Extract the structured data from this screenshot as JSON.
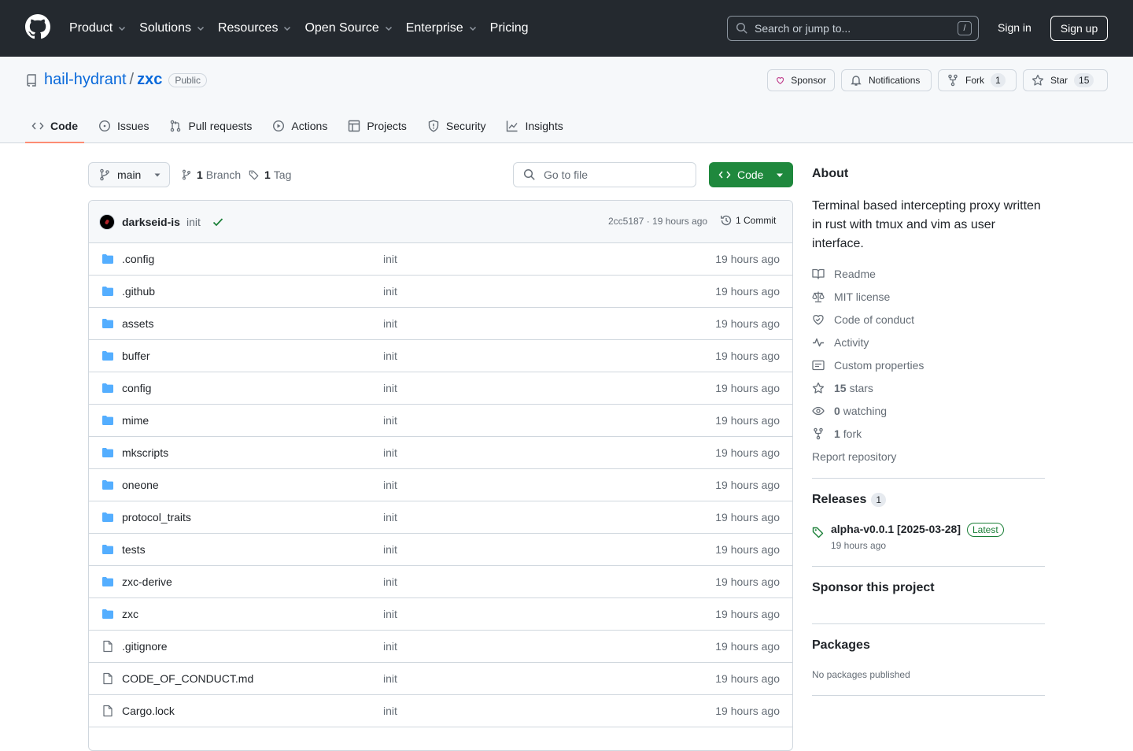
{
  "header": {
    "nav": [
      {
        "label": "Product",
        "has_dropdown": true
      },
      {
        "label": "Solutions",
        "has_dropdown": true
      },
      {
        "label": "Resources",
        "has_dropdown": true
      },
      {
        "label": "Open Source",
        "has_dropdown": true
      },
      {
        "label": "Enterprise",
        "has_dropdown": true
      },
      {
        "label": "Pricing",
        "has_dropdown": false
      }
    ],
    "search_placeholder": "Search or jump to...",
    "search_shortcut": "/",
    "sign_in": "Sign in",
    "sign_up": "Sign up"
  },
  "repo": {
    "owner": "hail-hydrant",
    "separator": "/",
    "name": "zxc",
    "visibility": "Public",
    "actions": {
      "sponsor": "Sponsor",
      "notifications": "Notifications",
      "fork": "Fork",
      "fork_count": "1",
      "star": "Star",
      "star_count": "15"
    },
    "tabs": [
      {
        "label": "Code",
        "icon": "code-icon",
        "active": true
      },
      {
        "label": "Issues",
        "icon": "issue-icon",
        "active": false
      },
      {
        "label": "Pull requests",
        "icon": "pull-request-icon",
        "active": false
      },
      {
        "label": "Actions",
        "icon": "play-icon",
        "active": false
      },
      {
        "label": "Projects",
        "icon": "table-icon",
        "active": false
      },
      {
        "label": "Security",
        "icon": "shield-icon",
        "active": false
      },
      {
        "label": "Insights",
        "icon": "graph-icon",
        "active": false
      }
    ]
  },
  "browser": {
    "branch": "main",
    "branch_count": "1",
    "branch_label": "Branch",
    "tag_count": "1",
    "tag_label": "Tag",
    "go_to_file": "Go to file",
    "code_button": "Code",
    "commit": {
      "author": "darkseid-is",
      "message": "init",
      "sha_time": "2cc5187 · 19 hours ago",
      "commits": "1 Commit"
    },
    "files": [
      {
        "name": ".config",
        "type": "dir",
        "message": "init",
        "age": "19 hours ago"
      },
      {
        "name": ".github",
        "type": "dir",
        "message": "init",
        "age": "19 hours ago"
      },
      {
        "name": "assets",
        "type": "dir",
        "message": "init",
        "age": "19 hours ago"
      },
      {
        "name": "buffer",
        "type": "dir",
        "message": "init",
        "age": "19 hours ago"
      },
      {
        "name": "config",
        "type": "dir",
        "message": "init",
        "age": "19 hours ago"
      },
      {
        "name": "mime",
        "type": "dir",
        "message": "init",
        "age": "19 hours ago"
      },
      {
        "name": "mkscripts",
        "type": "dir",
        "message": "init",
        "age": "19 hours ago"
      },
      {
        "name": "oneone",
        "type": "dir",
        "message": "init",
        "age": "19 hours ago"
      },
      {
        "name": "protocol_traits",
        "type": "dir",
        "message": "init",
        "age": "19 hours ago"
      },
      {
        "name": "tests",
        "type": "dir",
        "message": "init",
        "age": "19 hours ago"
      },
      {
        "name": "zxc-derive",
        "type": "dir",
        "message": "init",
        "age": "19 hours ago"
      },
      {
        "name": "zxc",
        "type": "dir",
        "message": "init",
        "age": "19 hours ago"
      },
      {
        "name": ".gitignore",
        "type": "file",
        "message": "init",
        "age": "19 hours ago"
      },
      {
        "name": "CODE_OF_CONDUCT.md",
        "type": "file",
        "message": "init",
        "age": "19 hours ago"
      },
      {
        "name": "Cargo.lock",
        "type": "file",
        "message": "init",
        "age": "19 hours ago"
      }
    ]
  },
  "about": {
    "heading": "About",
    "description": "Terminal based intercepting proxy written in rust with tmux and vim as user interface.",
    "links": [
      {
        "label": "Readme",
        "icon": "book-icon"
      },
      {
        "label": "MIT license",
        "icon": "law-icon"
      },
      {
        "label": "Code of conduct",
        "icon": "heart-hand-icon"
      },
      {
        "label": "Activity",
        "icon": "pulse-icon"
      },
      {
        "label": "Custom properties",
        "icon": "note-icon"
      }
    ],
    "stars_count": "15",
    "stars_label": "stars",
    "watching_count": "0",
    "watching_label": "watching",
    "fork_count": "1",
    "fork_label": "fork",
    "report": "Report repository"
  },
  "releases": {
    "heading": "Releases",
    "count": "1",
    "name": "alpha-v0.0.1 [2025-03-28]",
    "badge": "Latest",
    "time": "19 hours ago"
  },
  "sponsor": {
    "heading": "Sponsor this project"
  },
  "packages": {
    "heading": "Packages",
    "empty": "No packages published"
  },
  "colors": {
    "header_bg": "#24292f",
    "link": "#0969da",
    "primary_green": "#1f883d",
    "folder": "#54aeff",
    "active_tab_underline": "#fd8c73",
    "sponsor_heart": "#bf3989"
  }
}
